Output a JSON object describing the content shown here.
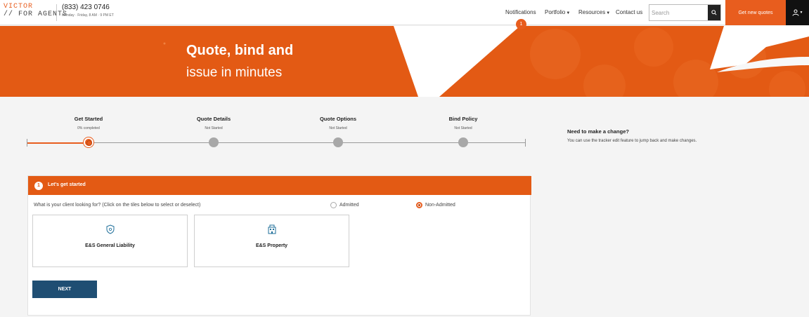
{
  "header": {
    "logo_top": "VICTOR",
    "logo_bottom": "// FOR AGENTS",
    "phone": "(833) 423 0746",
    "hours": "Monday · Friday, 8 AM · 9 PM ET",
    "nav": {
      "notifications": "Notifications",
      "notifications_count": "1",
      "portfolio": "Portfolio",
      "resources": "Resources",
      "contact": "Contact us"
    },
    "search_placeholder": "Search",
    "get_quotes": "Get new quotes"
  },
  "hero": {
    "title": "Quote, bind and",
    "subtitle": "issue in minutes"
  },
  "tracker": {
    "steps": [
      {
        "title": "Get Started",
        "status": "0% completed",
        "active": true
      },
      {
        "title": "Quote Details",
        "status": "Not Started",
        "active": false
      },
      {
        "title": "Quote Options",
        "status": "Not Started",
        "active": false
      },
      {
        "title": "Bind Policy",
        "status": "Not Started",
        "active": false
      }
    ]
  },
  "help": {
    "title": "Need to make a change?",
    "text": "You can use the tracker edit feature to jump back and make changes."
  },
  "card": {
    "step_number": "1",
    "title": "Let's get started",
    "question": "What is your client looking for? (Click on the tiles below to select or deselect)",
    "radio_admitted": "Admitted",
    "radio_non_admitted": "Non-Admitted",
    "selected_radio": "Non-Admitted",
    "tiles": [
      {
        "label": "E&S General Liability",
        "icon": "shield-icon"
      },
      {
        "label": "E&S Property",
        "icon": "building-icon"
      }
    ],
    "next_label": "NEXT"
  },
  "colors": {
    "brand_orange": "#e35a14",
    "next_blue": "#1f4e73"
  }
}
